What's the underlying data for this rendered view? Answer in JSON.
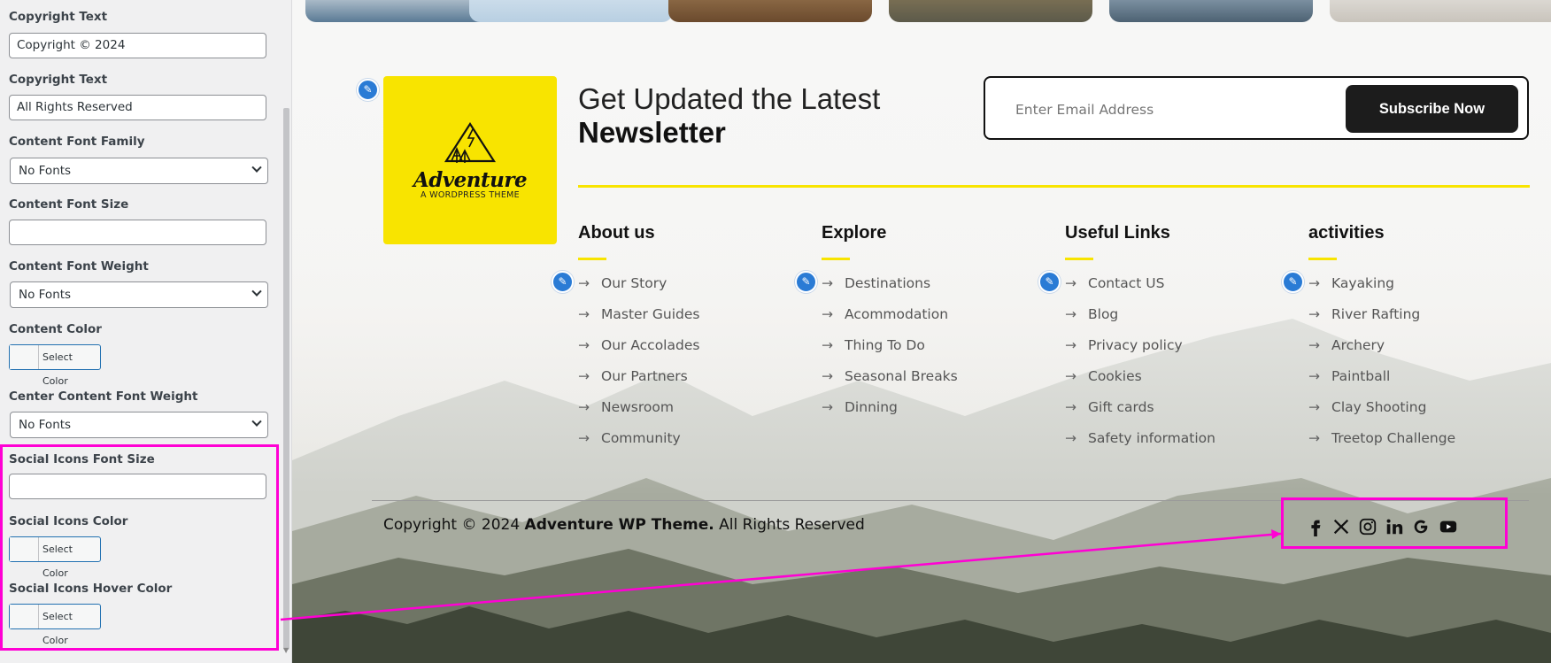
{
  "sidebar": {
    "fields": [
      {
        "label": "Copyright Text",
        "value": "Copyright © 2024"
      },
      {
        "label": "Copyright Text",
        "value": "All Rights Reserved"
      },
      {
        "label": "Content Font Family",
        "value": "No Fonts"
      },
      {
        "label": "Content Font Size",
        "value": ""
      },
      {
        "label": "Content Font Weight",
        "value": "No Fonts"
      },
      {
        "label": "Content Color",
        "button": "Select Color"
      },
      {
        "label": "Center Content Font Weight",
        "value": "No Fonts"
      },
      {
        "label": "Social Icons Font Size",
        "value": ""
      },
      {
        "label": "Social Icons Color",
        "button": "Select Color"
      },
      {
        "label": "Social Icons Hover Color",
        "button": "Select Color"
      }
    ]
  },
  "logo": {
    "title": "Adventure",
    "subtitle": "A WORDPRESS THEME"
  },
  "newsletter": {
    "line1": "Get Updated the Latest",
    "line2": "Newsletter",
    "email_placeholder": "Enter Email Address",
    "subscribe_label": "Subscribe Now"
  },
  "columns": [
    {
      "title": "About us",
      "items": [
        "Our Story",
        "Master Guides",
        "Our Accolades",
        "Our Partners",
        "Newsroom",
        "Community"
      ]
    },
    {
      "title": "Explore",
      "items": [
        "Destinations",
        "Acommodation",
        "Thing To Do",
        "Seasonal Breaks",
        "Dinning"
      ]
    },
    {
      "title": "Useful Links",
      "items": [
        "Contact US",
        "Blog",
        "Privacy policy",
        "Cookies",
        "Gift cards",
        "Safety information"
      ]
    },
    {
      "title": "activities",
      "items": [
        "Kayaking",
        "River Rafting",
        "Archery",
        "Paintball",
        "Clay Shooting",
        "Treetop Challenge"
      ]
    }
  ],
  "footer": {
    "copyright_prefix": "Copyright © 2024",
    "theme_name": "Adventure WP Theme.",
    "copyright_suffix": "All Rights Reserved"
  },
  "social_icons": [
    "facebook-icon",
    "x-twitter-icon",
    "instagram-icon",
    "linkedin-icon",
    "google-icon",
    "youtube-icon"
  ],
  "colors": {
    "accent_yellow": "#f8e400",
    "highlight_magenta": "#ff00d4",
    "edit_blue": "#2a7bd5",
    "button_dark": "#1c1c1c"
  }
}
